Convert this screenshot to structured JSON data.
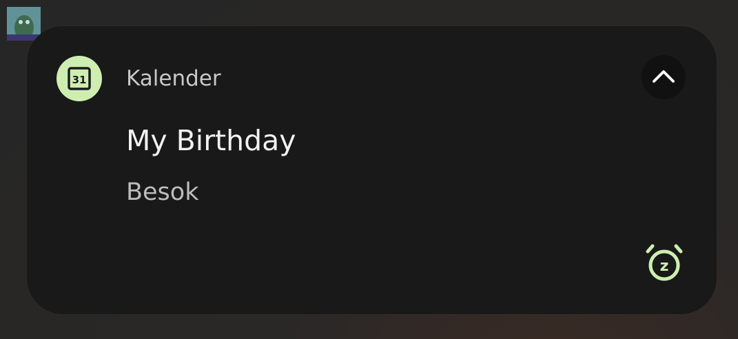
{
  "notification": {
    "app_name": "Kalender",
    "app_icon": "calendar-icon",
    "calendar_day": "31",
    "title": "My Birthday",
    "subtitle": "Besok",
    "collapse_icon": "chevron-up-icon",
    "snooze_icon": "snooze-alarm-icon",
    "snooze_letter": "z"
  },
  "colors": {
    "accent": "#cdeeb0",
    "card_background": "#191919",
    "title_text": "#f2f2f2",
    "secondary_text": "#bdbdbd"
  }
}
